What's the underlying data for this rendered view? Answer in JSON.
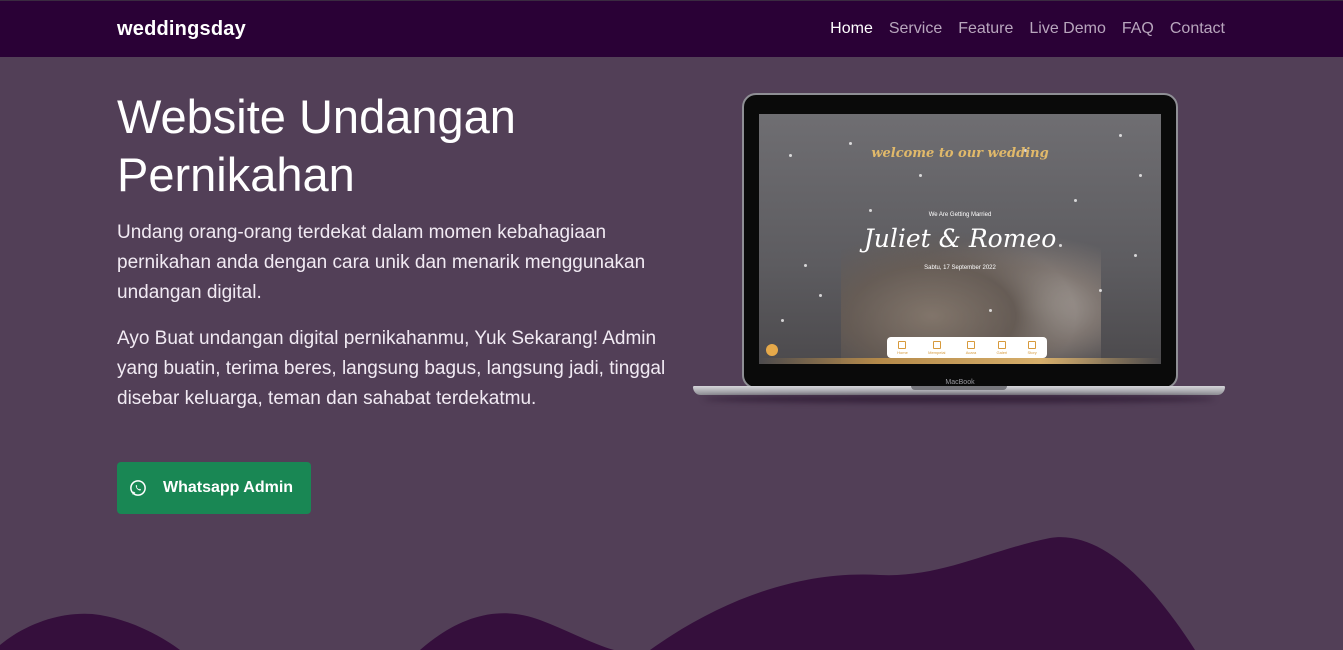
{
  "brand": "weddingsday",
  "nav": {
    "items": [
      {
        "label": "Home",
        "active": true
      },
      {
        "label": "Service",
        "active": false
      },
      {
        "label": "Feature",
        "active": false
      },
      {
        "label": "Live Demo",
        "active": false
      },
      {
        "label": "FAQ",
        "active": false
      },
      {
        "label": "Contact",
        "active": false
      }
    ]
  },
  "hero": {
    "title": "Website Undangan Pernikahan",
    "paragraph1": "Undang orang-orang terdekat dalam momen kebahagiaan pernikahan anda dengan cara unik dan menarik menggunakan undangan digital.",
    "paragraph2": "Ayo Buat undangan digital pernikahanmu, Yuk Sekarang! Admin yang buatin, terima beres, langsung bagus, langsung jadi, tinggal disebar keluarga, teman dan sahabat terdekatmu.",
    "cta": {
      "label": "Whatsapp Admin",
      "icon": "whatsapp-icon"
    }
  },
  "mockup": {
    "welcome": "welcome to our wedding",
    "tagline": "We Are Getting Married",
    "names": "Juliet & Romeo",
    "date": "Sabtu, 17 September 2022",
    "nav_items": [
      "Home",
      "Mempelai",
      "Acara",
      "Galeri",
      "Story"
    ],
    "laptop_label": "MacBook"
  },
  "colors": {
    "navbar": "#2a0136",
    "background": "#523f57",
    "button": "#198754",
    "wave": "#350f3c",
    "accent_gold": "#e1b96a"
  }
}
